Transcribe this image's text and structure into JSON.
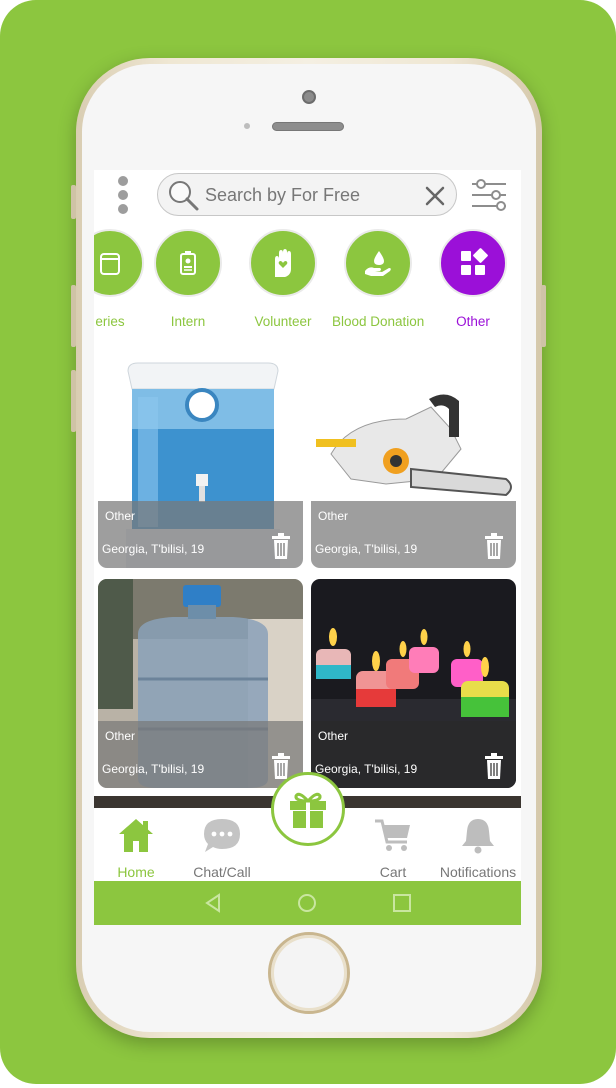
{
  "search": {
    "placeholder": "Search by For Free"
  },
  "categories": [
    {
      "label": "eries",
      "icon": "jar-icon"
    },
    {
      "label": "Intern",
      "icon": "id-badge-icon"
    },
    {
      "label": "Volunteer",
      "icon": "heart-hand-icon"
    },
    {
      "label": "Blood Donation",
      "icon": "blood-drop-hand-icon"
    },
    {
      "label": "Other",
      "icon": "grid-shapes-icon",
      "active": true
    }
  ],
  "items": [
    {
      "category": "Other",
      "location": "Georgia, T'bilisi, 19",
      "image": "water-purifier"
    },
    {
      "category": "Other",
      "location": "Georgia, T'bilisi, 19",
      "image": "chainsaw"
    },
    {
      "category": "Other",
      "location": "Georgia, T'bilisi, 19",
      "image": "water-bottle"
    },
    {
      "category": "Other",
      "location": "Georgia, T'bilisi, 19",
      "image": "candles"
    }
  ],
  "bottom_nav": {
    "home": "Home",
    "chat": "Chat/Call",
    "cart": "Cart",
    "notifications": "Notifications"
  },
  "colors": {
    "brand_green": "#8cc63f",
    "active_purple": "#9b10d8",
    "text_gray": "#777777"
  }
}
